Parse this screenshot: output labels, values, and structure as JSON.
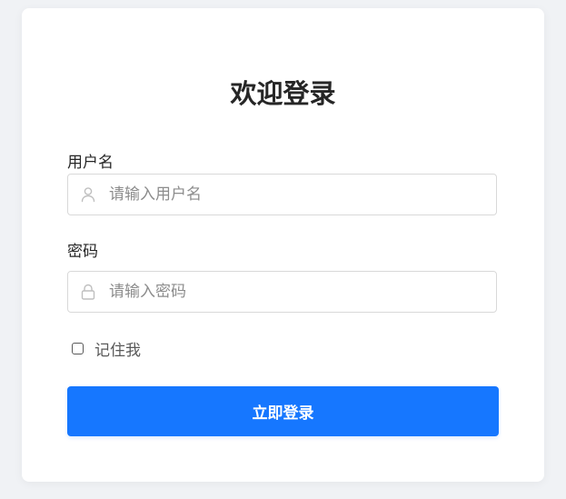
{
  "page": {
    "title": "欢迎登录"
  },
  "form": {
    "username": {
      "label": "用户名",
      "placeholder": "请输入用户名",
      "icon": "user-icon"
    },
    "password": {
      "label": "密码",
      "placeholder": "请输入密码",
      "icon": "lock-icon"
    },
    "remember": {
      "label": "记住我",
      "checked": false
    },
    "submit_label": "立即登录"
  },
  "colors": {
    "primary": "#1677ff",
    "background": "#f0f2f5",
    "card": "#ffffff",
    "border": "#d9d9d9",
    "placeholder": "#8c8c8c"
  }
}
